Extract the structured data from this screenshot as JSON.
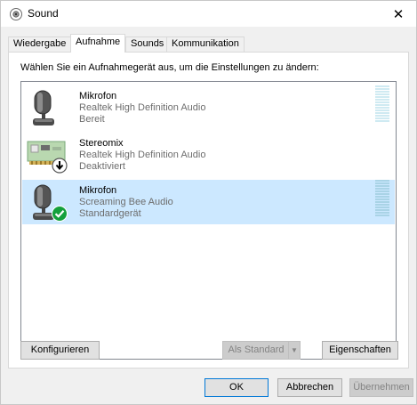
{
  "window": {
    "title": "Sound",
    "close_glyph": "✕"
  },
  "tabs": [
    {
      "label": "Wiedergabe",
      "active": false
    },
    {
      "label": "Aufnahme",
      "active": true
    },
    {
      "label": "Sounds",
      "active": false
    },
    {
      "label": "Kommunikation",
      "active": false
    }
  ],
  "panel": {
    "instruction": "Wählen Sie ein Aufnahmegerät aus, um die Einstellungen zu ändern:"
  },
  "devices": [
    {
      "name": "Mikrofon",
      "driver": "Realtek High Definition Audio",
      "state": "Bereit",
      "icon": "microphone-icon",
      "selected": false
    },
    {
      "name": "Stereomix",
      "driver": "Realtek High Definition Audio",
      "state": "Deaktiviert",
      "icon": "sound-card-icon",
      "badge": "disabled-arrow-badge",
      "selected": false
    },
    {
      "name": "Mikrofon",
      "driver": "Screaming Bee Audio",
      "state": "Standardgerät",
      "icon": "microphone-icon",
      "badge": "default-check-badge",
      "selected": true
    }
  ],
  "panel_buttons": {
    "configure": "Konfigurieren",
    "set_default": "Als Standard",
    "set_default_arrow": "▼",
    "properties": "Eigenschaften"
  },
  "dialog_buttons": {
    "ok": "OK",
    "cancel": "Abbrechen",
    "apply": "Übernehmen"
  },
  "colors": {
    "selection": "#cce8ff",
    "meter": "#cfeaf2",
    "check_badge": "#14a03c"
  }
}
